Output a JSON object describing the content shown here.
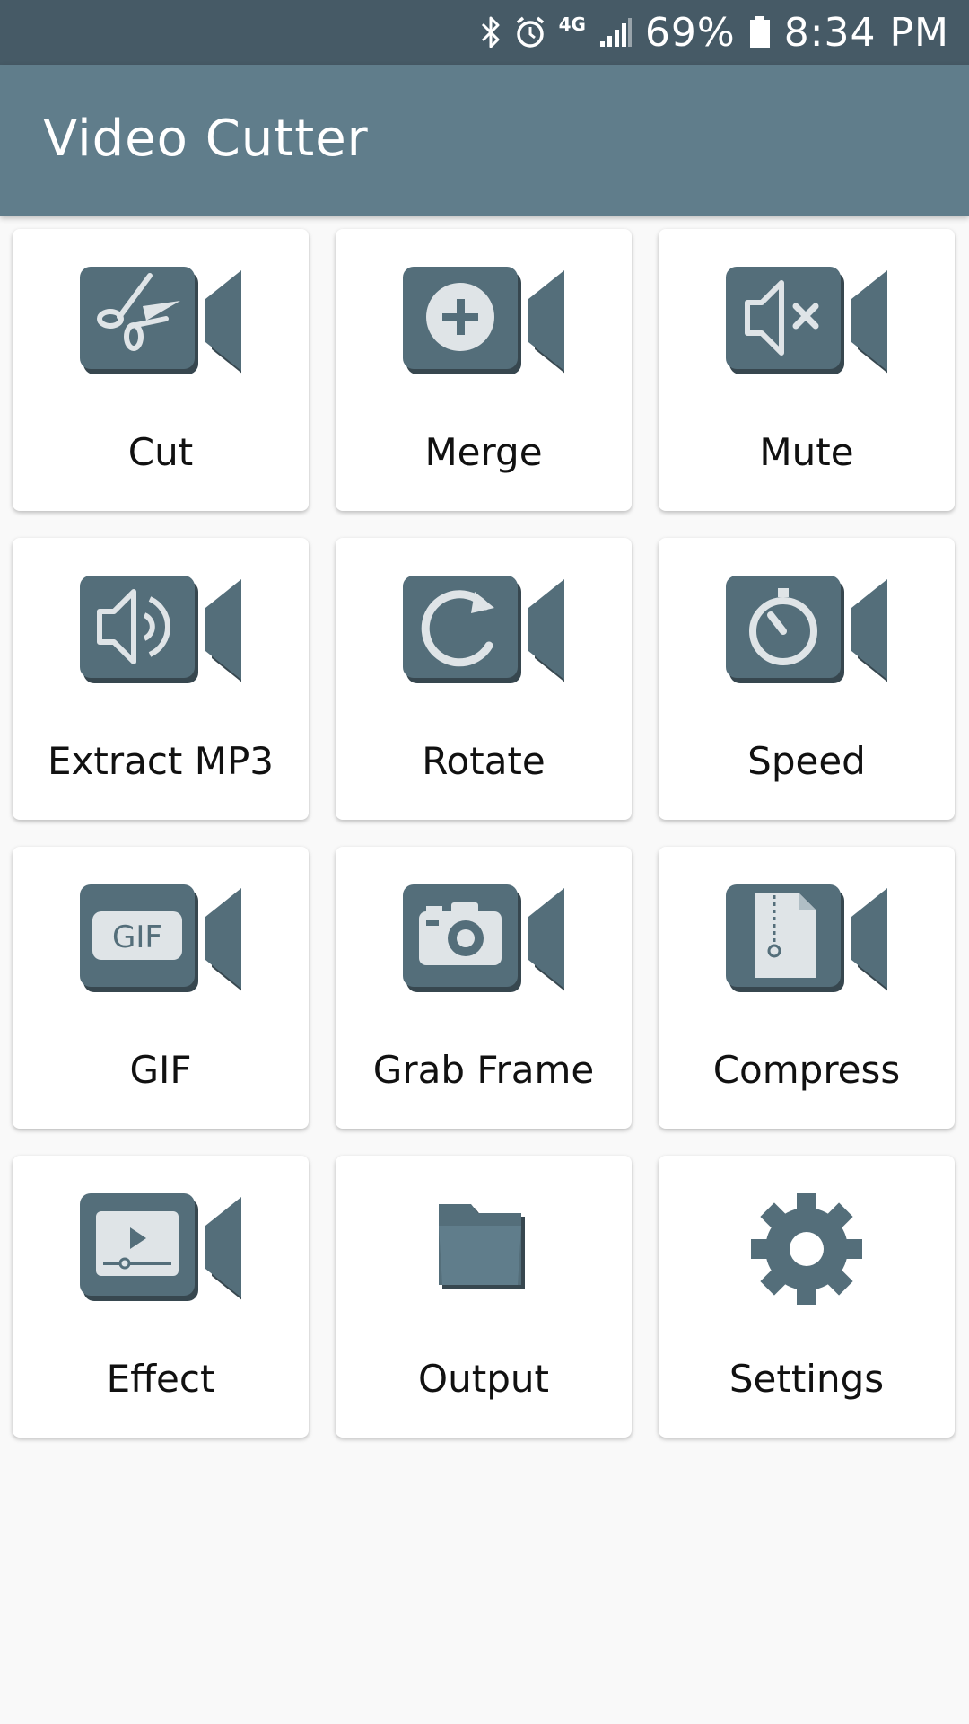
{
  "status_bar": {
    "network": "4G",
    "battery_percent": "69%",
    "time": "8:34 PM",
    "icons": [
      "bluetooth-icon",
      "alarm-icon",
      "signal-icon",
      "battery-icon"
    ]
  },
  "app_bar": {
    "title": "Video Cutter",
    "color": "#607d8b"
  },
  "theme": {
    "icon_color": "#546e7a",
    "icon_symbol_color": "#dfe4e7"
  },
  "tiles": [
    {
      "label": "Cut",
      "icon": "scissors-video-icon"
    },
    {
      "label": "Merge",
      "icon": "merge-video-icon"
    },
    {
      "label": "Mute",
      "icon": "mute-video-icon"
    },
    {
      "label": "Extract MP3",
      "icon": "extract-audio-video-icon"
    },
    {
      "label": "Rotate",
      "icon": "rotate-video-icon"
    },
    {
      "label": "Speed",
      "icon": "speed-video-icon"
    },
    {
      "label": "GIF",
      "icon": "gif-video-icon",
      "icon_text": "GIF"
    },
    {
      "label": "Grab Frame",
      "icon": "camera-video-icon"
    },
    {
      "label": "Compress",
      "icon": "compress-video-icon"
    },
    {
      "label": "Effect",
      "icon": "effect-video-icon"
    },
    {
      "label": "Output",
      "icon": "folder-icon"
    },
    {
      "label": "Settings",
      "icon": "gear-icon"
    }
  ]
}
